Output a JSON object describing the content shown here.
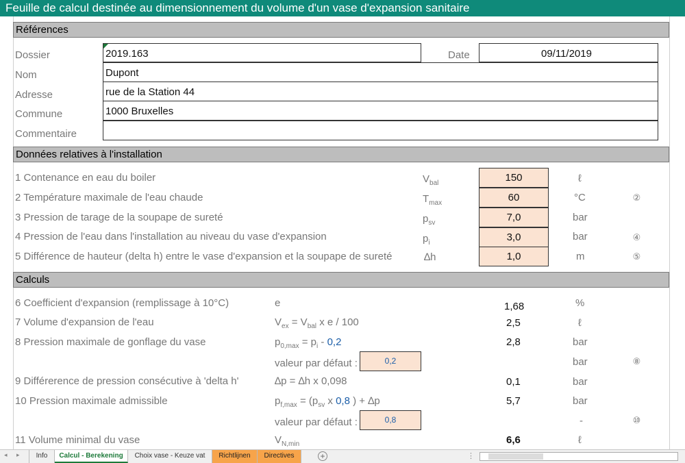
{
  "title": "Feuille de calcul destinée au dimensionnement du volume d'un vase d'expansion sanitaire",
  "references": {
    "header": "Références",
    "dossier_label": "Dossier",
    "dossier_value": "2019.163",
    "date_label": "Date",
    "date_value": "09/11/2019",
    "nom_label": "Nom",
    "nom_value": "Dupont",
    "adresse_label": "Adresse",
    "adresse_value": "rue de la Station 44",
    "commune_label": "Commune",
    "commune_value": "1000 Bruxelles",
    "commentaire_label": "Commentaire",
    "commentaire_value": ""
  },
  "installation": {
    "header": "Données relatives à l'installation",
    "rows": [
      {
        "label": "1 Contenance en eau du boiler",
        "sym": "V",
        "sub": "bal",
        "value": "150",
        "unit": "ℓ",
        "note": ""
      },
      {
        "label": "2 Température maximale de l'eau chaude",
        "sym": "T",
        "sub": "max",
        "value": "60",
        "unit": "°C",
        "note": "2"
      },
      {
        "label": "3 Pression de tarage de la soupape de sureté",
        "sym": "p",
        "sub": "sv",
        "value": "7,0",
        "unit": "bar",
        "note": ""
      },
      {
        "label": "4 Pression de l'eau dans l'installation au niveau du vase d'expansion",
        "sym": "p",
        "sub": "i",
        "value": "3,0",
        "unit": "bar",
        "note": "4"
      },
      {
        "label": "5 Différence de hauteur (delta h) entre le vase d'expansion et la soupape de sureté",
        "sym": "∆h",
        "sub": "",
        "value": "1,0",
        "unit": "m",
        "note": "5"
      }
    ]
  },
  "calculs": {
    "header": "Calculs",
    "r6": {
      "label": "6 Coefficient d'expansion (remplissage à 10°C)",
      "formula": "e",
      "value": "1,68",
      "unit": "%"
    },
    "r7": {
      "label": "7 Volume d'expansion de l'eau",
      "f1": "V",
      "f1sub": "ex",
      "f2": " = V",
      "f2sub": "bal",
      "f3": " x e / 100",
      "value": "2,5",
      "unit": "ℓ"
    },
    "r8": {
      "label": "8 Pression maximale de gonflage du vase",
      "f1": "p",
      "f1sub": "0,max",
      "f2": " =   p",
      "f2sub": "i",
      "f3": " - ",
      "fblue": "0,2",
      "value": "2,8",
      "unit": "bar"
    },
    "r8d": {
      "label": "valeur par défaut :",
      "value": "0,2",
      "unit": "bar",
      "note": "8"
    },
    "r9": {
      "label": "9 Différerence de pression consécutive à 'delta h'",
      "formula": "∆p = ∆h x 0,098",
      "value": "0,1",
      "unit": "bar"
    },
    "r10": {
      "label": "10 Pression maximale admissible",
      "f1": "p",
      "f1sub": "f,max",
      "f2": " = (p",
      "f2sub": "sv",
      "f3": " x  ",
      "fblue": "0,8",
      "f4": "  ) + ∆p",
      "value": "5,7",
      "unit": "bar"
    },
    "r10d": {
      "label": "valeur par défaut :",
      "value": "0,8",
      "unit": "-",
      "note": "10"
    },
    "r11": {
      "label": "11 Volume minimal du vase",
      "f1": "V",
      "f1sub": "N,min",
      "value": "6,6",
      "unit": "ℓ"
    }
  },
  "tabs": [
    {
      "label": "Info"
    },
    {
      "label": "Calcul - Berekening"
    },
    {
      "label": "Choix vase - Keuze vat"
    },
    {
      "label": "Richtlijnen"
    },
    {
      "label": "Directives"
    }
  ],
  "add_sheet": "+",
  "colors": {
    "title_bg": "#0f8a7a",
    "input_bg": "#fbe3d2",
    "section_bg": "#bdbdbd",
    "active_tab": "#1d7a3a",
    "orange_tab": "#f7a44a",
    "formula_blue": "#1c5ea8"
  }
}
